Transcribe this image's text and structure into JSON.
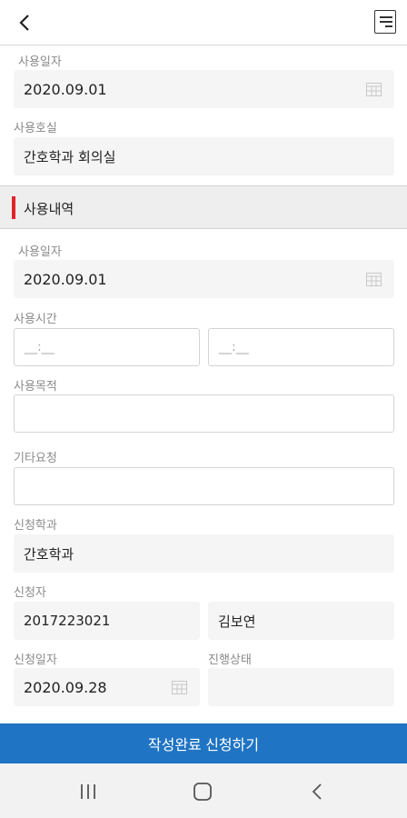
{
  "header": {
    "back_icon": "chevron-left-icon",
    "menu_icon": "menu-icon"
  },
  "top": {
    "use_date_label": "사용일자",
    "use_date_value": "2020.09.01",
    "room_label": "사용호실",
    "room_value": "간호학과 회의실"
  },
  "section": {
    "title": "사용내역"
  },
  "details": {
    "use_date_label": "사용일자",
    "use_date_value": "2020.09.01",
    "use_time_label": "사용시간",
    "start_time_placeholder": "__:__",
    "end_time_placeholder": "__:__",
    "purpose_label": "사용목적",
    "purpose_value": "",
    "other_label": "기타요청",
    "other_value": "",
    "dept_label": "신청학과",
    "dept_value": "간호학과",
    "applicant_label": "신청자",
    "applicant_id": "2017223021",
    "applicant_name": "김보연",
    "apply_date_label": "신청일자",
    "apply_date_value": "2020.09.28",
    "status_label": "진행상태",
    "status_value": ""
  },
  "submit_label": "작성완료 신청하기",
  "navbar": {
    "recents_icon": "recents-icon",
    "home_icon": "home-icon",
    "back_icon": "back-icon"
  },
  "colors": {
    "accent": "#1f74c3",
    "section_mark": "#e0242b",
    "field_bg": "#f5f5f5"
  }
}
